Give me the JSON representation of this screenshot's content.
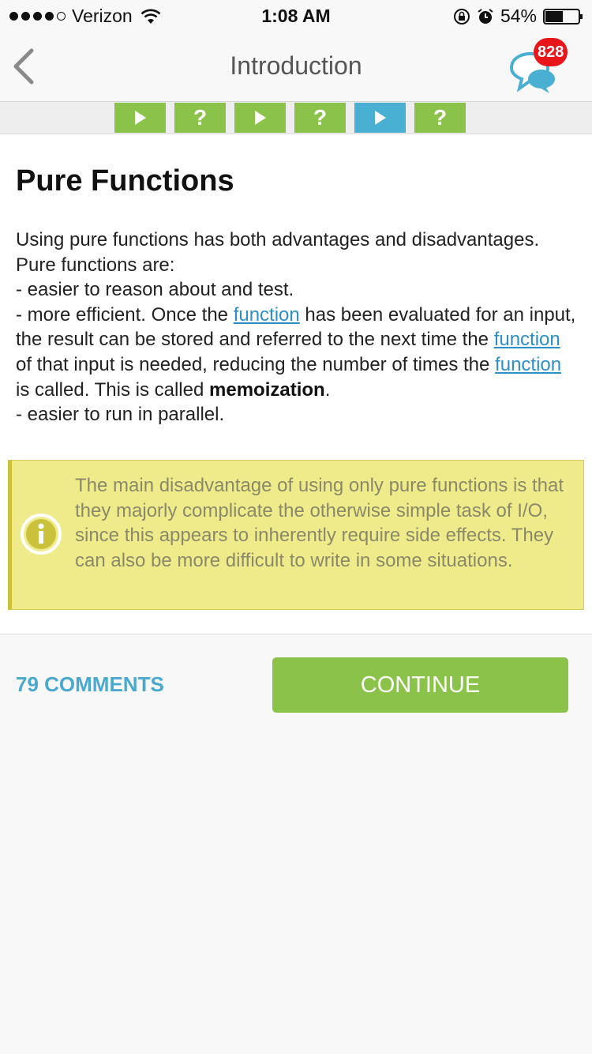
{
  "status_bar": {
    "carrier": "Verizon",
    "time": "1:08 AM",
    "battery_percent": "54%",
    "battery_level": 0.54,
    "signal_bars_filled": 4,
    "signal_bars_total": 5
  },
  "nav": {
    "title": "Introduction",
    "back_icon": "chevron-left-icon",
    "chat_badge_count": "828",
    "chat_icon": "chat-bubbles-icon"
  },
  "progress": {
    "steps": [
      {
        "type": "play",
        "label": "",
        "state": "done"
      },
      {
        "type": "quiz",
        "label": "?",
        "state": "done"
      },
      {
        "type": "play",
        "label": "",
        "state": "done"
      },
      {
        "type": "quiz",
        "label": "?",
        "state": "done"
      },
      {
        "type": "play",
        "label": "",
        "state": "current"
      },
      {
        "type": "quiz",
        "label": "?",
        "state": "done"
      }
    ]
  },
  "lesson": {
    "title": "Pure Functions",
    "intro_line_1": "Using pure functions has both advantages and disadvantages.",
    "intro_line_2": "Pure functions are:",
    "point_1": "- easier to reason about and test.",
    "point_2_a": "- more efficient. Once the ",
    "link_1": "function",
    "point_2_b": " has been evaluated for an input, the result can be stored and referred to the next time the ",
    "link_2": "function",
    "point_2_c": " of that input is needed, reducing the number of times the ",
    "link_3": "function",
    "point_2_d": " is called. This is called ",
    "bold_term": "memoization",
    "point_2_e": ".",
    "point_3": "- easier to run in parallel.",
    "note": "The main disadvantage of using only pure functions is that they majorly complicate the otherwise simple task of I/O, since this appears to inherently require side effects. They can also be more difficult to write in some situations."
  },
  "footer": {
    "comments_label": "79 COMMENTS",
    "continue_label": "CONTINUE"
  },
  "colors": {
    "green": "#8bc34a",
    "blue": "#4ab0d3",
    "note_bg": "#efea8a",
    "badge_red": "#e8151b",
    "link": "#2d8fc7"
  }
}
